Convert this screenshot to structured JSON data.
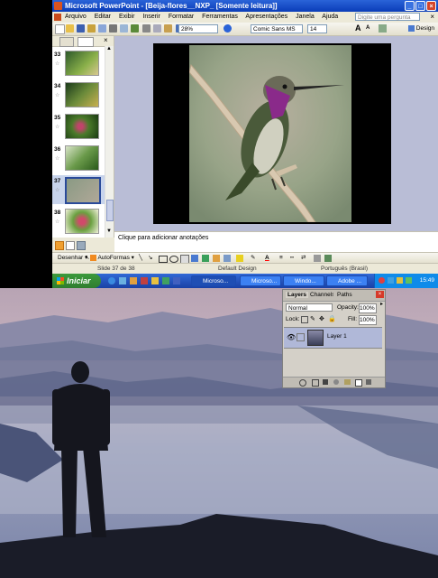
{
  "ppt": {
    "title": "Microsoft PowerPoint - [Beija-flores__NXP_ [Somente leitura]]",
    "menu": [
      "Arquivo",
      "Editar",
      "Exibir",
      "Inserir",
      "Formatar",
      "Ferramentas",
      "Apresentações",
      "Janela",
      "Ajuda"
    ],
    "help_placeholder": "Digite uma pergunta",
    "zoom": "28%",
    "font": "Comic Sans MS",
    "font_size": "14",
    "design_label": "Design",
    "slides": [
      {
        "num": "33"
      },
      {
        "num": "34"
      },
      {
        "num": "35"
      },
      {
        "num": "36"
      },
      {
        "num": "37"
      },
      {
        "num": "38"
      }
    ],
    "notes_placeholder": "Clique para adicionar anotações",
    "draw_label": "Desenhar",
    "autoshapes_label": "AutoFormas",
    "status": {
      "slide": "Slide 37 de 38",
      "design": "Default Design",
      "language": "Português (Brasil)"
    }
  },
  "taskbar": {
    "start": "Iniciar",
    "tasks": [
      "Microso...",
      "Microso...",
      "Windo...",
      "Adobe ..."
    ],
    "clock": "15:49"
  },
  "layers_panel": {
    "tabs": [
      "Layers",
      "Channels",
      "Paths"
    ],
    "blend_mode": "Normal",
    "opacity_label": "Opacity:",
    "opacity": "100%",
    "lock_label": "Lock:",
    "fill_label": "Fill:",
    "fill": "100%",
    "layer_name": "Layer 1"
  }
}
